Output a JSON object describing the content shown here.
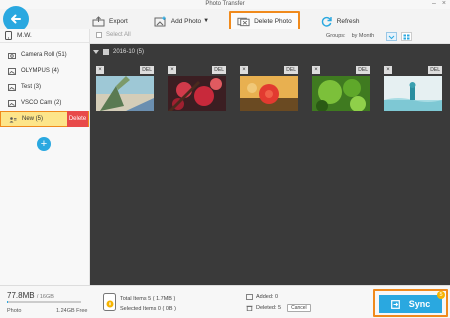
{
  "window": {
    "title": "Photo Transfer"
  },
  "toolbar": {
    "export_label": "Export",
    "add_photo_label": "Add Photo",
    "delete_photo_label": "Delete Photo",
    "refresh_label": "Refresh"
  },
  "sidebar": {
    "device_name": "M.W.",
    "albums": [
      {
        "label": "Camera Roll (51)"
      },
      {
        "label": "OLYMPUS (4)"
      },
      {
        "label": "Test (3)"
      },
      {
        "label": "VSCO Cam (2)"
      },
      {
        "label": "New (5)",
        "delete_label": "Delete"
      }
    ]
  },
  "subbar": {
    "select_all": "Select All",
    "groups_label": "Groups:",
    "groups_value": "by Month"
  },
  "gallery": {
    "group_label": "2016-10 (5)",
    "del_label": "DEL",
    "photos": [
      {
        "name": "photo-1"
      },
      {
        "name": "photo-2"
      },
      {
        "name": "photo-3"
      },
      {
        "name": "photo-4"
      },
      {
        "name": "photo-5"
      }
    ]
  },
  "footer": {
    "storage_used": "77.8MB",
    "storage_total": "/ 16GB",
    "storage_fraction": 0.005,
    "storage_label": "Photo",
    "storage_free": "1.24GB Free",
    "total_items": "Total Items 5 ( 1.7MB )",
    "selected_items": "Selected Items 0 ( 0B )",
    "added": "Added: 0",
    "deleted": "Deleted: 5",
    "cancel": "Cancel",
    "sync_label": "Sync",
    "sync_badge": "5"
  },
  "colors": {
    "accent": "#2aa8e0",
    "highlight": "#f08a1c",
    "danger": "#e84a4a"
  }
}
